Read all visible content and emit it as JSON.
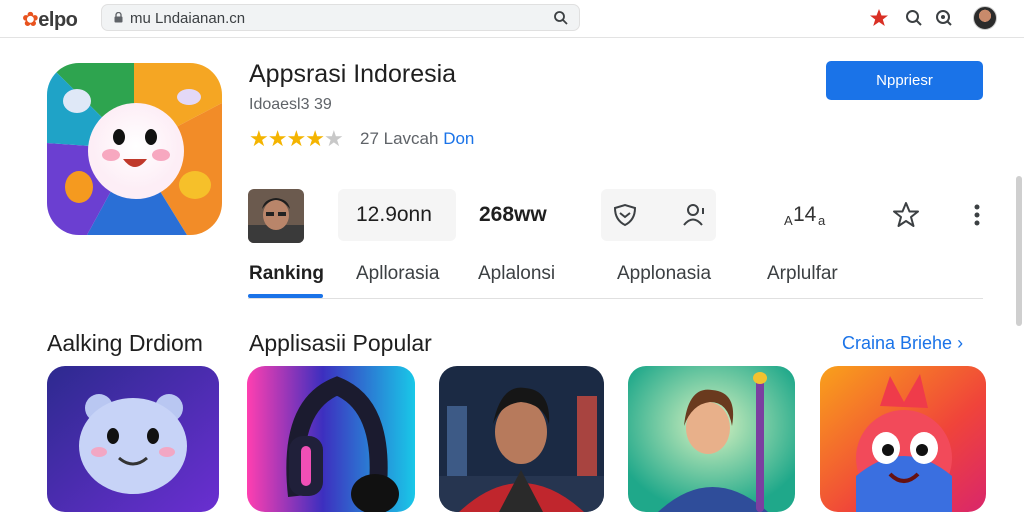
{
  "browser": {
    "logo": "elpo",
    "url": "mu Lndaianan.cn"
  },
  "colors": {
    "accent": "#1a73e8",
    "star": "#f4b400",
    "logo_mark": "#e8531e"
  },
  "app": {
    "title": "Appsrasi Indoresia",
    "subtitle": "Idoaesl3 39",
    "rating_stars": 4,
    "reviews_count": "27 Lavcah",
    "reviews_link": "Don",
    "install_label": "Nppriesr"
  },
  "stats": {
    "stat1": "12.9onn",
    "stat2": "268ww",
    "stat3": "14",
    "stat3_prefix": "A",
    "stat3_suffix": "a"
  },
  "tabs": [
    {
      "label": "Ranking",
      "active": true
    },
    {
      "label": "Apllorasia",
      "active": false
    },
    {
      "label": "Aplalonsi",
      "active": false
    },
    {
      "label": "Applonasia",
      "active": false
    },
    {
      "label": "Arplulfar",
      "active": false
    }
  ],
  "sections": {
    "left_title": "Aalking Drdiom",
    "main_title": "Applisasii Popular",
    "see_more": "Craina Briehe"
  },
  "icons": [
    "lock-icon",
    "search-icon",
    "star-icon",
    "zoom-icon",
    "settings-icon",
    "shield-icon",
    "person-add-icon",
    "star-outline-icon",
    "more-vert-icon",
    "chevron-right-icon"
  ]
}
